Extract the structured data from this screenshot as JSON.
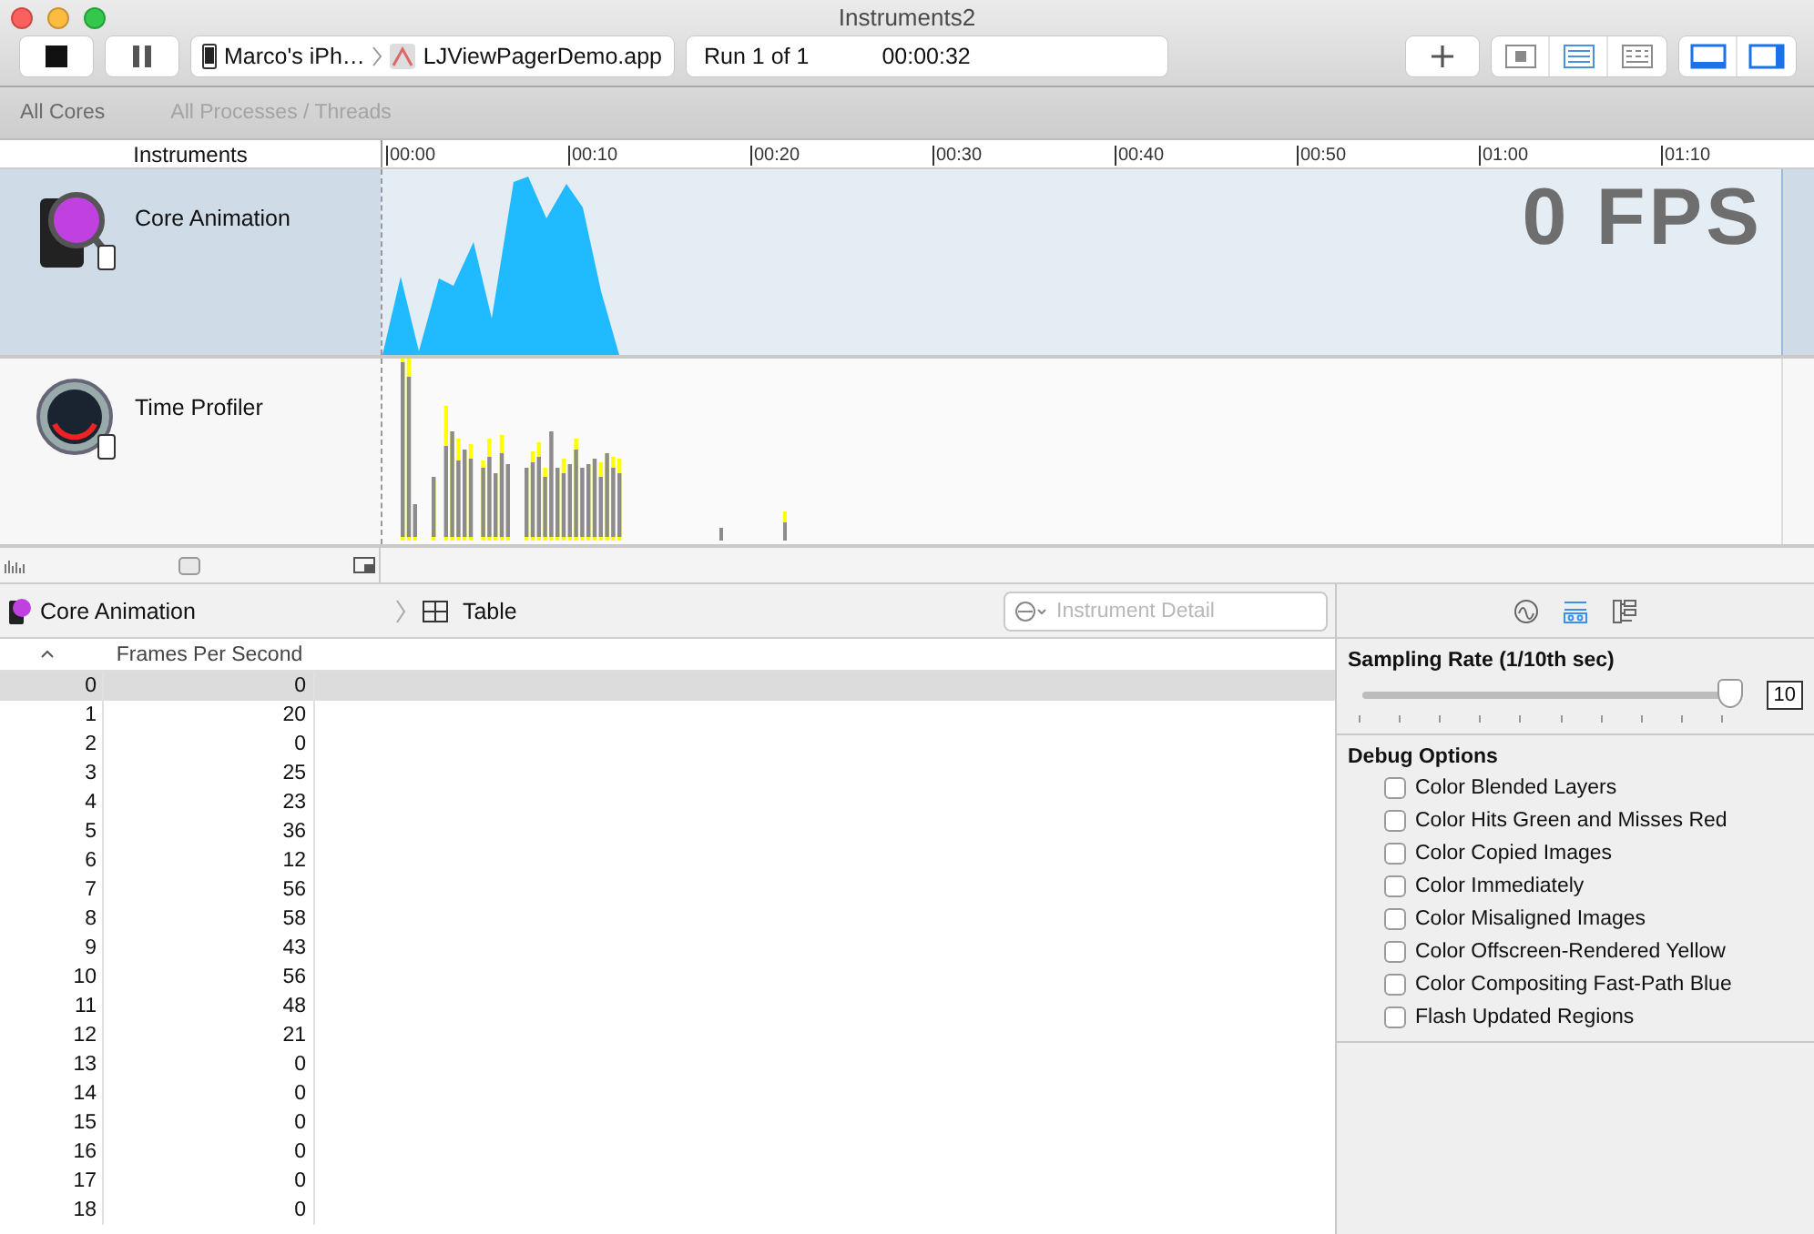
{
  "window": {
    "title": "Instruments2"
  },
  "toolbar": {
    "scheme_device": "Marco's iPh…",
    "scheme_app": "LJViewPagerDemo.app",
    "run": "Run 1 of 1",
    "time": "00:00:32",
    "segments": [
      {
        "kind": "cpu",
        "selected": false
      },
      {
        "kind": "list",
        "selected": true
      },
      {
        "kind": "grid",
        "selected": false
      }
    ],
    "views": [
      {
        "kind": "bottom",
        "selected": true
      },
      {
        "kind": "right",
        "selected": true
      }
    ]
  },
  "filters": [
    {
      "label": "All Cores",
      "disabled": false
    },
    {
      "label": "All Processes / Threads",
      "disabled": true
    }
  ],
  "ruler": {
    "heading": "Instruments",
    "ticks": [
      "00:00",
      "00:10",
      "00:20",
      "00:30",
      "00:40",
      "00:50",
      "01:00",
      "01:10"
    ]
  },
  "tracks": [
    {
      "name": "Core Animation",
      "kind": "area",
      "selected": true,
      "reading": "0 FPS"
    },
    {
      "name": "Time Profiler",
      "kind": "bars",
      "selected": false
    }
  ],
  "detail_bar": {
    "instrument": "Core Animation",
    "view": "Table",
    "search": {
      "placeholder": "Instrument Detail"
    }
  },
  "table": {
    "columns": [
      "Frames Per Second"
    ],
    "rows": [
      {
        "index": "0",
        "fps": "0",
        "selected": true
      },
      {
        "index": "1",
        "fps": "20",
        "selected": false
      },
      {
        "index": "2",
        "fps": "0",
        "selected": false
      },
      {
        "index": "3",
        "fps": "25",
        "selected": false
      },
      {
        "index": "4",
        "fps": "23",
        "selected": false
      },
      {
        "index": "5",
        "fps": "36",
        "selected": false
      },
      {
        "index": "6",
        "fps": "12",
        "selected": false
      },
      {
        "index": "7",
        "fps": "56",
        "selected": false
      },
      {
        "index": "8",
        "fps": "58",
        "selected": false
      },
      {
        "index": "9",
        "fps": "43",
        "selected": false
      },
      {
        "index": "10",
        "fps": "56",
        "selected": false
      },
      {
        "index": "11",
        "fps": "48",
        "selected": false
      },
      {
        "index": "12",
        "fps": "21",
        "selected": false
      },
      {
        "index": "13",
        "fps": "0",
        "selected": false
      },
      {
        "index": "14",
        "fps": "0",
        "selected": false
      },
      {
        "index": "15",
        "fps": "0",
        "selected": false
      },
      {
        "index": "16",
        "fps": "0",
        "selected": false
      },
      {
        "index": "17",
        "fps": "0",
        "selected": false
      },
      {
        "index": "18",
        "fps": "0",
        "selected": false
      }
    ]
  },
  "inspector": {
    "tabs": [
      {
        "kind": "wave",
        "selected": false
      },
      {
        "kind": "options",
        "selected": true
      },
      {
        "kind": "tree",
        "selected": false
      }
    ],
    "sampling": {
      "label": "Sampling Rate (1/10th sec)",
      "level": 0.97,
      "value": "10"
    },
    "debug_title": "Debug Options",
    "options": [
      {
        "label": "Color Blended Layers",
        "checked": false
      },
      {
        "label": "Color Hits Green and Misses Red",
        "checked": false
      },
      {
        "label": "Color Copied Images",
        "checked": false
      },
      {
        "label": "Color Immediately",
        "checked": false
      },
      {
        "label": "Color Misaligned Images",
        "checked": false
      },
      {
        "label": "Color Offscreen-Rendered Yellow",
        "checked": false
      },
      {
        "label": "Color Compositing Fast-Path Blue",
        "checked": false
      },
      {
        "label": "Flash Updated Regions",
        "checked": false
      }
    ]
  }
}
